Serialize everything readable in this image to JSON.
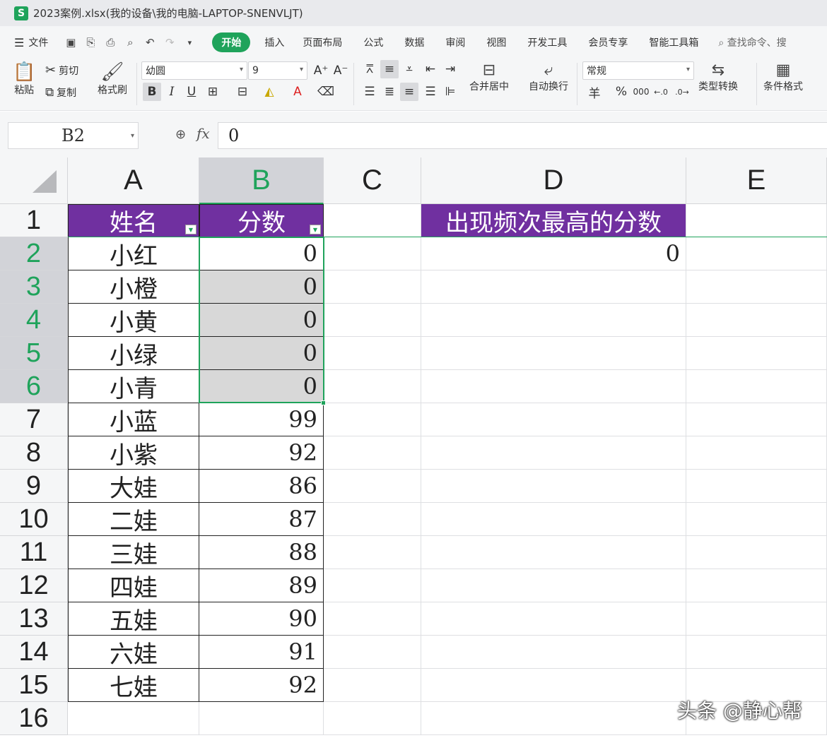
{
  "window": {
    "app_badge": "S",
    "title": "2023案例.xlsx(我的设备\\我的电脑-LAPTOP-SNENVLJT)"
  },
  "menubar": {
    "file_label": "文件",
    "tabs": [
      "开始",
      "插入",
      "页面布局",
      "公式",
      "数据",
      "审阅",
      "视图",
      "开发工具",
      "会员专享",
      "智能工具箱"
    ],
    "search": "查找命令、搜"
  },
  "ribbon": {
    "paste": "粘贴",
    "cut": "剪切",
    "copy": "复制",
    "format_painter": "格式刷",
    "font_name": "幼圆",
    "font_size": "9",
    "merge_center": "合并居中",
    "wrap_text": "自动换行",
    "number_format": "常规",
    "type_convert": "类型转换",
    "conditional_format": "条件格式",
    "currency_symbol": "羊",
    "percent_symbol": "%",
    "thousands_symbol": "000"
  },
  "formula_bar": {
    "cell_ref": "B2",
    "fx": "fx",
    "value": "0"
  },
  "columns": [
    "A",
    "B",
    "C",
    "D",
    "E"
  ],
  "rows": [
    "1",
    "2",
    "3",
    "4",
    "5",
    "6",
    "7",
    "8",
    "9",
    "10",
    "11",
    "12",
    "13",
    "14",
    "15",
    "16"
  ],
  "table": {
    "header_name": "姓名",
    "header_score": "分数",
    "names": [
      "小红",
      "小橙",
      "小黄",
      "小绿",
      "小青",
      "小蓝",
      "小紫",
      "大娃",
      "二娃",
      "三娃",
      "四娃",
      "五娃",
      "六娃",
      "七娃"
    ],
    "scores": [
      "0",
      "0",
      "0",
      "0",
      "0",
      "99",
      "92",
      "86",
      "87",
      "88",
      "89",
      "90",
      "91",
      "92"
    ]
  },
  "result": {
    "header": "出现频次最高的分数",
    "value": "0"
  },
  "colors": {
    "header_purple": "#7030a0",
    "accent_green": "#1fa35b",
    "selection_gray": "#d8d8d8"
  },
  "watermark": "头条 @静心帮"
}
